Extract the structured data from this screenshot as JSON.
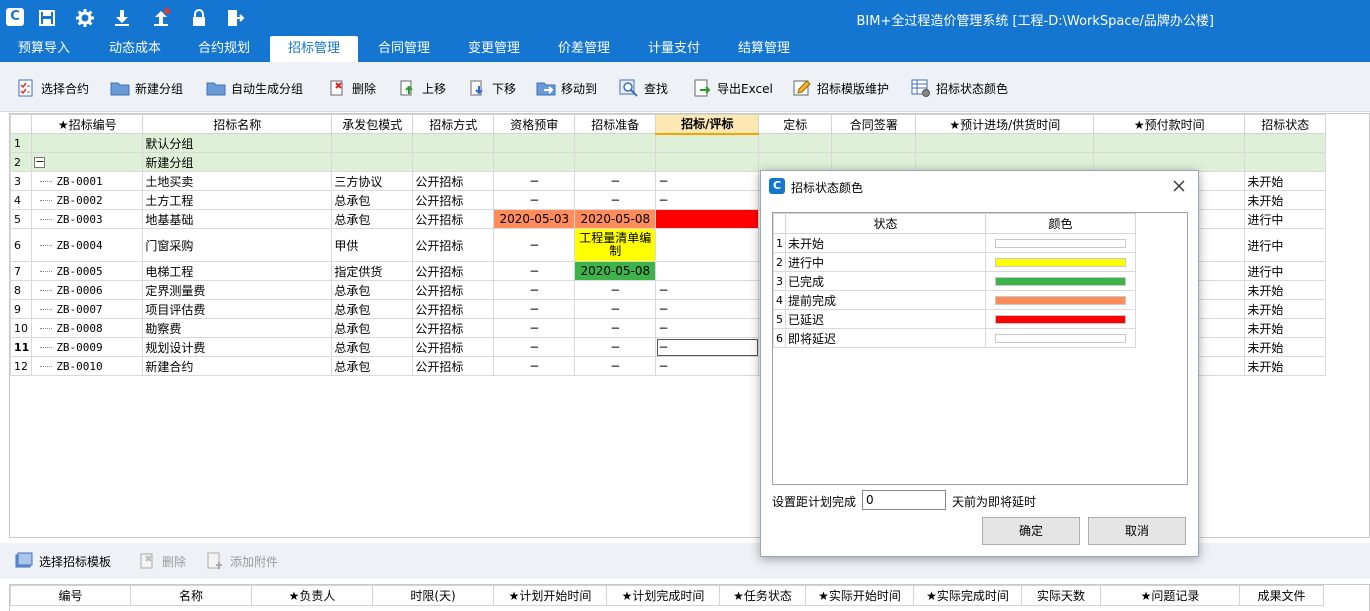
{
  "app": {
    "title": "BIM+全过程造价管理系统 [工程-D:\\WorkSpace/品牌办公楼]",
    "logo_letter": "C",
    "quick_icons": [
      "save-icon",
      "gear-icon",
      "download-icon",
      "upload-icon",
      "lock-icon",
      "exit-icon"
    ]
  },
  "menu": {
    "tabs": [
      {
        "label": "预算导入",
        "active": false
      },
      {
        "label": "动态成本",
        "active": false
      },
      {
        "label": "合约规划",
        "active": false
      },
      {
        "label": "招标管理",
        "active": true
      },
      {
        "label": "合同管理",
        "active": false
      },
      {
        "label": "变更管理",
        "active": false
      },
      {
        "label": "价差管理",
        "active": false
      },
      {
        "label": "计量支付",
        "active": false
      },
      {
        "label": "结算管理",
        "active": false
      }
    ]
  },
  "toolbar": {
    "select_contract": "选择合约",
    "new_group": "新建分组",
    "auto_group": "自动生成分组",
    "delete": "删除",
    "move_up": "上移",
    "move_down": "下移",
    "move_to": "移动到",
    "find": "查找",
    "export_excel": "导出Excel",
    "template_maint": "招标模版维护",
    "status_color": "招标状态颜色"
  },
  "grid": {
    "columns": [
      "★招标编号",
      "招标名称",
      "承发包模式",
      "招标方式",
      "资格预审",
      "招标准备",
      "招标/评标",
      "定标",
      "合同签署",
      "★预计进场/供货时间",
      "★预付款时间",
      "招标状态"
    ],
    "active_column": "招标/评标",
    "groups": [
      {
        "row": "1",
        "name": "默认分组"
      },
      {
        "row": "2",
        "name": "新建分组",
        "toggle": "−"
      }
    ],
    "rows": [
      {
        "row": "3",
        "code": "ZB-0001",
        "name": "土地买卖",
        "mode": "三方协议",
        "method": "公开招标",
        "prequal": "−",
        "prep": "−",
        "bid": "−",
        "status": "未开始"
      },
      {
        "row": "4",
        "code": "ZB-0002",
        "name": "土方工程",
        "mode": "总承包",
        "method": "公开招标",
        "prequal": "−",
        "prep": "−",
        "bid": "−",
        "status": "未开始"
      },
      {
        "row": "5",
        "code": "ZB-0003",
        "name": "地基基础",
        "mode": "总承包",
        "method": "公开招标",
        "prequal": "2020-05-03",
        "prep": "2020-05-08",
        "bid": "",
        "status": "进行中"
      },
      {
        "row": "6",
        "code": "ZB-0004",
        "name": "门窗采购",
        "mode": "甲供",
        "method": "公开招标",
        "prequal": "−",
        "prep": "工程量清单编制",
        "bid": "",
        "status": "进行中"
      },
      {
        "row": "7",
        "code": "ZB-0005",
        "name": "电梯工程",
        "mode": "指定供货",
        "method": "公开招标",
        "prequal": "−",
        "prep": "2020-05-08",
        "bid": "",
        "status": "进行中"
      },
      {
        "row": "8",
        "code": "ZB-0006",
        "name": "定界测量费",
        "mode": "总承包",
        "method": "公开招标",
        "prequal": "−",
        "prep": "−",
        "bid": "−",
        "status": "未开始"
      },
      {
        "row": "9",
        "code": "ZB-0007",
        "name": "项目评估费",
        "mode": "总承包",
        "method": "公开招标",
        "prequal": "−",
        "prep": "−",
        "bid": "−",
        "status": "未开始"
      },
      {
        "row": "10",
        "code": "ZB-0008",
        "name": "勘察费",
        "mode": "总承包",
        "method": "公开招标",
        "prequal": "−",
        "prep": "−",
        "bid": "−",
        "status": "未开始"
      },
      {
        "row": "11",
        "code": "ZB-0009",
        "name": "规划设计费",
        "mode": "总承包",
        "method": "公开招标",
        "prequal": "−",
        "prep": "−",
        "bid": "−",
        "status": "未开始"
      },
      {
        "row": "12",
        "code": "ZB-0010",
        "name": "新建合约",
        "mode": "总承包",
        "method": "公开招标",
        "prequal": "−",
        "prep": "−",
        "bid": "−",
        "status": "未开始"
      }
    ]
  },
  "bottom_toolbar": {
    "select_template": "选择招标模板",
    "delete": "删除",
    "add_attachment": "添加附件"
  },
  "bottom_grid": {
    "columns": [
      "编号",
      "名称",
      "★负责人",
      "时限(天)",
      "★计划开始时间",
      "★计划完成时间",
      "★任务状态",
      "★实际开始时间",
      "★实际完成时间",
      "实际天数",
      "★问题记录",
      "成果文件"
    ]
  },
  "dialog": {
    "title": "招标状态颜色",
    "col_status": "状态",
    "col_color": "颜色",
    "statuses": [
      {
        "row": "1",
        "name": "未开始",
        "color": "#ffffff"
      },
      {
        "row": "2",
        "name": "进行中",
        "color": "#ffff00"
      },
      {
        "row": "3",
        "name": "已完成",
        "color": "#3cb44a"
      },
      {
        "row": "4",
        "name": "提前完成",
        "color": "#ff8c5a"
      },
      {
        "row": "5",
        "name": "已延迟",
        "color": "#ff0000"
      },
      {
        "row": "6",
        "name": "即将延迟",
        "color": "#ffffff"
      }
    ],
    "threshold_label": "设置距计划完成",
    "threshold_value": "0",
    "threshold_suffix": "天前为即将延时",
    "ok": "确定",
    "cancel": "取消"
  },
  "colors": {
    "brand": "#1476d1",
    "group_row": "#dff0d8",
    "active_header": "#fde7b2"
  }
}
